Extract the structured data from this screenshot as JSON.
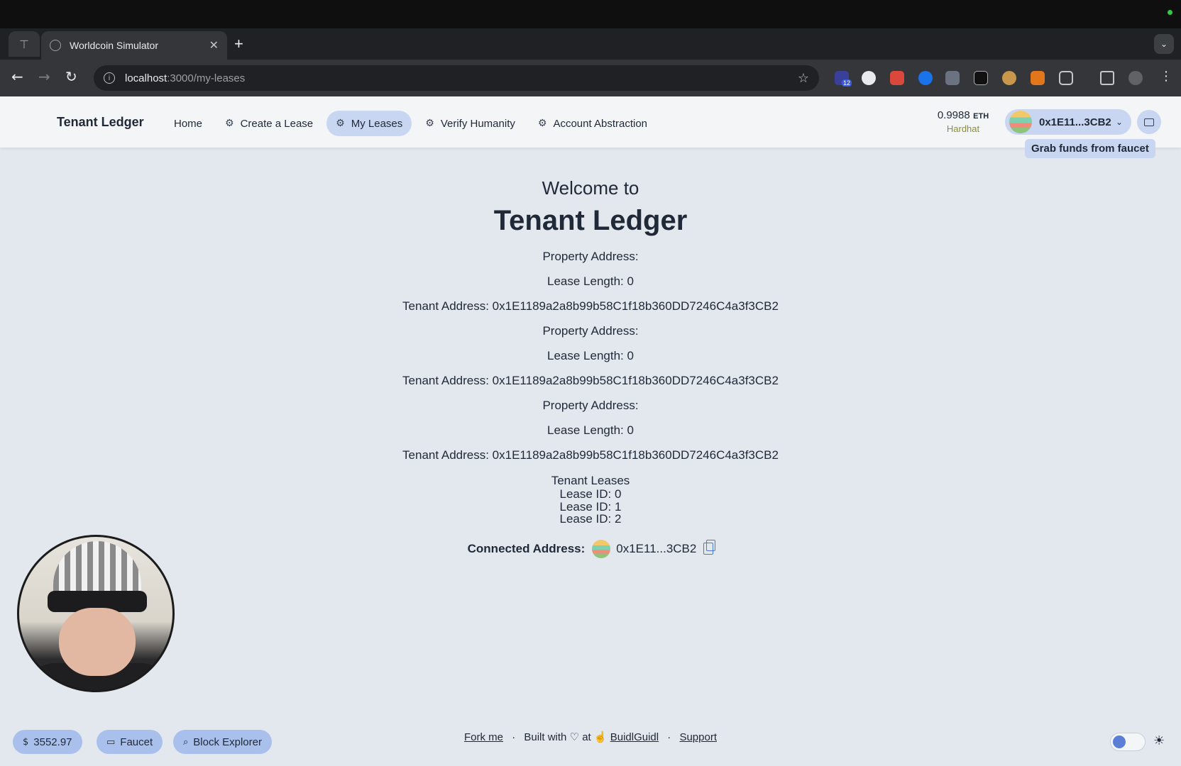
{
  "browser": {
    "tab_title": "Worldcoin Simulator",
    "tab_close": "✕",
    "new_tab": "+",
    "url_host": "localhost",
    "url_path": ":3000/my-leases",
    "ext_badge": "12"
  },
  "header": {
    "brand": "Tenant Ledger",
    "nav": [
      {
        "label": "Home"
      },
      {
        "label": "Create a Lease"
      },
      {
        "label": "My Leases"
      },
      {
        "label": "Verify Humanity"
      },
      {
        "label": "Account Abstraction"
      }
    ],
    "balance": "0.9988",
    "balance_unit": "ETH",
    "network": "Hardhat",
    "account": "0x1E11...3CB2",
    "faucet_tooltip": "Grab funds from faucet"
  },
  "main": {
    "welcome": "Welcome to",
    "heading": "Tenant Ledger",
    "leases": [
      {
        "property": "Property Address:",
        "length": "Lease Length: 0",
        "tenant": "Tenant Address: 0x1E1189a2a8b99b58C1f18b360DD7246C4a3f3CB2"
      },
      {
        "property": "Property Address:",
        "length": "Lease Length: 0",
        "tenant": "Tenant Address: 0x1E1189a2a8b99b58C1f18b360DD7246C4a3f3CB2"
      },
      {
        "property": "Property Address:",
        "length": "Lease Length: 0",
        "tenant": "Tenant Address: 0x1E1189a2a8b99b58C1f18b360DD7246C4a3f3CB2"
      }
    ],
    "tenant_leases_title": "Tenant Leases",
    "lease_ids": [
      "Lease ID: 0",
      "Lease ID: 1",
      "Lease ID: 2"
    ],
    "connected_label": "Connected Address:",
    "connected_address": "0x1E11...3CB2"
  },
  "footer": {
    "price": "3552.97",
    "faucet": "Faucet",
    "block_explorer": "Block Explorer",
    "fork_me": "Fork me",
    "built_with": "Built with",
    "at": "at",
    "buidlguidl": "BuidlGuidl",
    "support": "Support"
  }
}
